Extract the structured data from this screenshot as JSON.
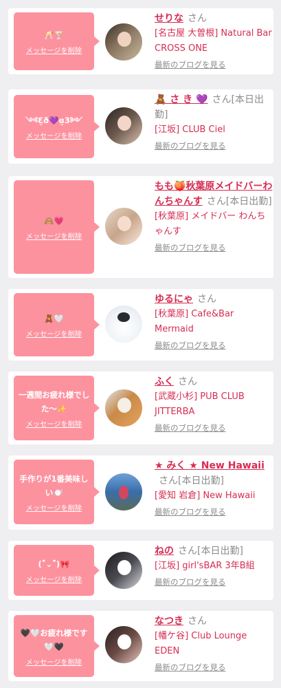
{
  "delete_label": "メッセージを削除",
  "blog_label": "最新のブログを見る",
  "suffix_san": "さん",
  "colors": {
    "accent": "#d62d52",
    "bubble": "#fd929f",
    "background": "#efeff1"
  },
  "items": [
    {
      "message": "🥂🍸",
      "name": "せりな",
      "suffix": "さん",
      "shop": "[名古屋 大曽根] Natural Bar CROSS ONE"
    },
    {
      "message": "༺Ɛ̮ð💜ɞ̮3༻",
      "name": "🧸 さ き 💜",
      "suffix": "さん[本日出勤]",
      "shop": "[江坂] CLUB Ciel"
    },
    {
      "message": "🙈💗",
      "name": "もも🍑秋葉原メイドバーわんちゃんす",
      "suffix": "さん[本日出勤]",
      "shop": "[秋葉原] メイドバー わんちゃんす"
    },
    {
      "message": "🧸🤍",
      "name": "ゆるにゃ",
      "suffix": "さん",
      "shop": "[秋葉原] Cafe&Bar Mermaid"
    },
    {
      "message": "一週間お疲れ様でした〜✨",
      "name": "ふく",
      "suffix": "さん",
      "shop": "[武蔵小杉] PUB CLUB JITTERBA"
    },
    {
      "message": "手作りが1番美味しい🍽️",
      "name": "★ みく ★ New Hawaii",
      "suffix": "さん[本日出勤]",
      "shop": "[愛知 岩倉] New Hawaii"
    },
    {
      "message": "(¯͒⌄¯͒)🎀",
      "name": "ねの",
      "suffix": "さん[本日出勤]",
      "shop": "[江坂] girl'sBAR 3年B組"
    },
    {
      "message": "🖤🤍お疲れ様です🤍🖤",
      "name": "なつき",
      "suffix": "さん",
      "shop": "[幡ケ谷] Club Lounge EDEN"
    }
  ]
}
